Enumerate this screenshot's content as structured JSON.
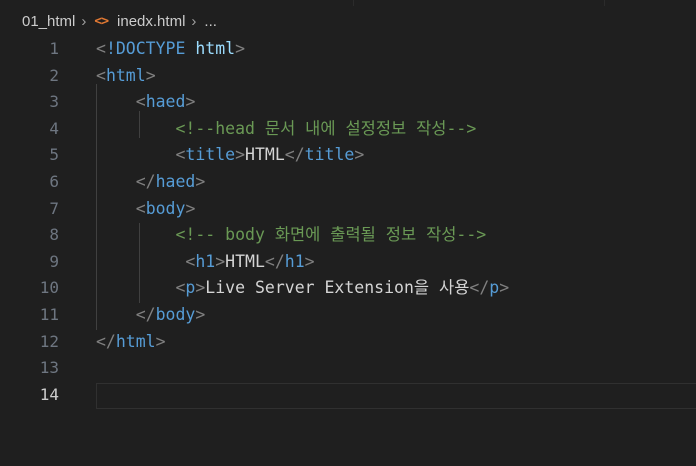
{
  "breadcrumb": {
    "folder": "01_html",
    "file_icon_glyph": "<>",
    "file": "inedx.html",
    "more": "..."
  },
  "editor": {
    "active_line": 14,
    "lines": [
      {
        "num": "1",
        "tokens": [
          {
            "c": "t-punct",
            "t": "<"
          },
          {
            "c": "t-doctype",
            "t": "!DOCTYPE"
          },
          {
            "c": "t-text",
            "t": " "
          },
          {
            "c": "t-doctype-name",
            "t": "html"
          },
          {
            "c": "t-punct",
            "t": ">"
          }
        ]
      },
      {
        "num": "2",
        "tokens": [
          {
            "c": "t-punct",
            "t": "<"
          },
          {
            "c": "t-tag",
            "t": "html"
          },
          {
            "c": "t-punct",
            "t": ">"
          }
        ]
      },
      {
        "num": "3",
        "tokens": [
          {
            "c": "t-text",
            "t": "    "
          },
          {
            "c": "t-punct",
            "t": "<"
          },
          {
            "c": "t-tag",
            "t": "haed"
          },
          {
            "c": "t-punct",
            "t": ">"
          }
        ]
      },
      {
        "num": "4",
        "tokens": [
          {
            "c": "t-text",
            "t": "        "
          },
          {
            "c": "t-comment",
            "t": "<!--head 문서 내에 설정정보 작성-->"
          }
        ]
      },
      {
        "num": "5",
        "tokens": [
          {
            "c": "t-text",
            "t": "        "
          },
          {
            "c": "t-punct",
            "t": "<"
          },
          {
            "c": "t-tag",
            "t": "title"
          },
          {
            "c": "t-punct",
            "t": ">"
          },
          {
            "c": "t-text",
            "t": "HTML"
          },
          {
            "c": "t-punct",
            "t": "</"
          },
          {
            "c": "t-tag",
            "t": "title"
          },
          {
            "c": "t-punct",
            "t": ">"
          }
        ]
      },
      {
        "num": "6",
        "tokens": [
          {
            "c": "t-text",
            "t": "    "
          },
          {
            "c": "t-punct",
            "t": "</"
          },
          {
            "c": "t-tag",
            "t": "haed"
          },
          {
            "c": "t-punct",
            "t": ">"
          }
        ]
      },
      {
        "num": "7",
        "tokens": [
          {
            "c": "t-text",
            "t": "    "
          },
          {
            "c": "t-punct",
            "t": "<"
          },
          {
            "c": "t-tag",
            "t": "body"
          },
          {
            "c": "t-punct",
            "t": ">"
          }
        ]
      },
      {
        "num": "8",
        "tokens": [
          {
            "c": "t-text",
            "t": "        "
          },
          {
            "c": "t-comment",
            "t": "<!-- body 화면에 출력될 정보 작성-->"
          }
        ]
      },
      {
        "num": "9",
        "tokens": [
          {
            "c": "t-text",
            "t": "         "
          },
          {
            "c": "t-punct",
            "t": "<"
          },
          {
            "c": "t-tag",
            "t": "h1"
          },
          {
            "c": "t-punct",
            "t": ">"
          },
          {
            "c": "t-text",
            "t": "HTML"
          },
          {
            "c": "t-punct",
            "t": "</"
          },
          {
            "c": "t-tag",
            "t": "h1"
          },
          {
            "c": "t-punct",
            "t": ">"
          }
        ]
      },
      {
        "num": "10",
        "tokens": [
          {
            "c": "t-text",
            "t": "        "
          },
          {
            "c": "t-punct",
            "t": "<"
          },
          {
            "c": "t-tag",
            "t": "p"
          },
          {
            "c": "t-punct",
            "t": ">"
          },
          {
            "c": "t-text",
            "t": "Live Server Extension을 사용"
          },
          {
            "c": "t-punct",
            "t": "</"
          },
          {
            "c": "t-tag",
            "t": "p"
          },
          {
            "c": "t-punct",
            "t": ">"
          }
        ]
      },
      {
        "num": "11",
        "tokens": [
          {
            "c": "t-text",
            "t": "    "
          },
          {
            "c": "t-punct",
            "t": "</"
          },
          {
            "c": "t-tag",
            "t": "body"
          },
          {
            "c": "t-punct",
            "t": ">"
          }
        ]
      },
      {
        "num": "12",
        "tokens": [
          {
            "c": "t-punct",
            "t": "</"
          },
          {
            "c": "t-tag",
            "t": "html"
          },
          {
            "c": "t-punct",
            "t": ">"
          }
        ]
      },
      {
        "num": "13",
        "tokens": []
      },
      {
        "num": "14",
        "tokens": []
      }
    ]
  }
}
